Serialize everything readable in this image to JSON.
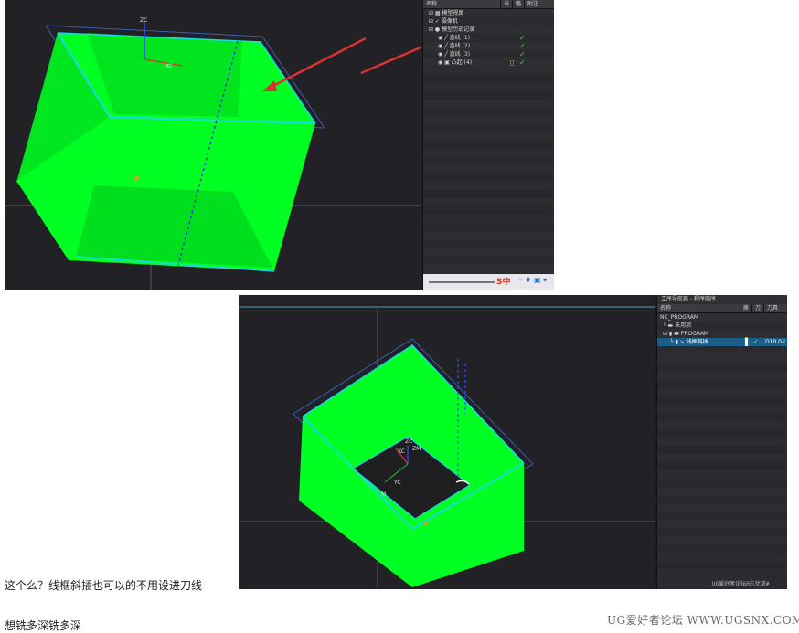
{
  "screenshot1": {
    "navigator": {
      "headers": [
        "名称",
        "当",
        "略",
        "附注"
      ],
      "items": [
        {
          "label": "模型视图",
          "check": false
        },
        {
          "label": "摄像机",
          "check": false
        },
        {
          "label": "模型历史记录",
          "check": false
        },
        {
          "label": "直线 (1)",
          "check": true
        },
        {
          "label": "直线 (2)",
          "check": true
        },
        {
          "label": "直线 (3)",
          "check": true
        },
        {
          "label": "凸起 (4)",
          "check": true
        }
      ],
      "ime_watermark": "S中"
    },
    "axis_labels": {
      "zc": "ZC",
      "xc": "XC"
    }
  },
  "screenshot2": {
    "navigator": {
      "title": "工序导航器 - 程序顺序",
      "headers": [
        "名称",
        "换",
        "刀",
        "刀具"
      ],
      "items": [
        {
          "label": "NC_PROGRAM",
          "col3": "",
          "selected": false
        },
        {
          "label": "未用项",
          "col3": "",
          "selected": false
        },
        {
          "label": "PROGRAM",
          "col3": "",
          "selected": false
        },
        {
          "label": "线框斜插",
          "col3": "D10.0-i",
          "selected": true
        }
      ],
      "forum_watermark": "UG爱好者论坛@忘忧草#"
    },
    "axis_labels": {
      "zc": "ZC",
      "xc": "XC",
      "yc": "YC",
      "zm": "ZM",
      "xm": "XM",
      "m": "M"
    }
  },
  "caption_line1": "这个么？线框斜插也可以的不用设进刀线",
  "caption_line2": "想铣多深铣多深",
  "site_watermark": "UG爱好者论坛 WWW.UGSNX.COM",
  "colors": {
    "model_green": "#00ff22",
    "edge_cyan": "#22d4e8",
    "outline_blue": "#3a5fb0",
    "arrow_red": "#e03030",
    "check_green": "#35e035"
  }
}
